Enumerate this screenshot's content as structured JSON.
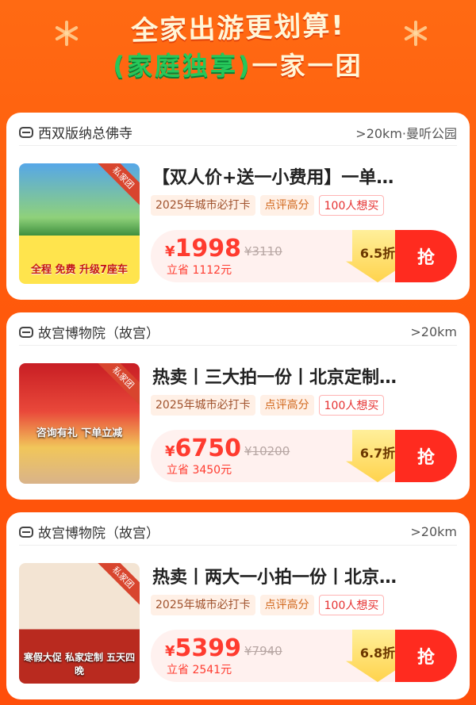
{
  "header": {
    "line1": "全家出游更划算!",
    "line2_highlight": "(家庭独享)",
    "line2_rest": "一家一团"
  },
  "cards": [
    {
      "location": "西双版纳总佛寺",
      "distance": ">20km·曼听公园",
      "title": "【双人价+送一小费用】一单…",
      "tags": [
        "2025年城市必打卡",
        "点评高分",
        "100人想买"
      ],
      "price_symbol": "¥",
      "price": "1998",
      "original_price": "¥3110",
      "save": "立省 1112元",
      "discount": "6.5折",
      "button": "抢",
      "thumb_corner": "私家团",
      "thumb_caption": "全程 免费 升级7座车"
    },
    {
      "location": "故宫博物院（故宫）",
      "distance": ">20km",
      "title": "热卖丨三大拍一份丨北京定制…",
      "tags": [
        "2025年城市必打卡",
        "点评高分",
        "100人想买"
      ],
      "price_symbol": "¥",
      "price": "6750",
      "original_price": "¥10200",
      "save": "立省 3450元",
      "discount": "6.7折",
      "button": "抢",
      "thumb_corner": "私家团",
      "thumb_caption": "咨询有礼 下单立减"
    },
    {
      "location": "故宫博物院（故宫）",
      "distance": ">20km",
      "title": "热卖丨两大一小拍一份丨北京…",
      "tags": [
        "2025年城市必打卡",
        "点评高分",
        "100人想买"
      ],
      "price_symbol": "¥",
      "price": "5399",
      "original_price": "¥7940",
      "save": "立省 2541元",
      "discount": "6.8折",
      "button": "抢",
      "thumb_corner": "私家团",
      "thumb_caption": "寒假大促 私家定制 五天四晚"
    }
  ]
}
